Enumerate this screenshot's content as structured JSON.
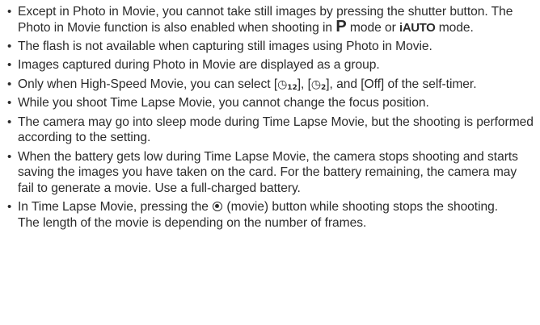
{
  "notes": {
    "item1": {
      "part1": "Except in Photo in Movie, you cannot take still images by pressing the shutter button. The Photo in Movie function is also enabled when shooting in ",
      "mode_p": "P",
      "part2": " mode or ",
      "mode_iauto": "iAUTO",
      "part3": " mode."
    },
    "item2": "The flash is not available when capturing still images using Photo in Movie.",
    "item3": "Images captured during Photo in Movie are displayed as a group.",
    "item4": {
      "part1": "Only when High-Speed Movie, you can select [",
      "timer_icon_1_sub": "12",
      "part2": "], [",
      "timer_icon_2_sub": "2",
      "part3": "], and [Off] of the self-timer."
    },
    "item5": "While you shoot Time Lapse Movie, you cannot change the focus position.",
    "item6": "The camera may go into sleep mode during Time Lapse Movie, but the shooting is performed according to the setting.",
    "item7": "When the battery gets low during Time Lapse Movie, the camera stops shooting and starts saving the images you have taken on the card. For the battery remaining, the camera may fail to generate a movie. Use a full-charged battery.",
    "item8": {
      "part1": "In Time Lapse Movie, pressing the ",
      "part2": " (movie) button while shooting stops the shooting.",
      "followup": "The length of the movie is depending on the number of frames."
    }
  },
  "icons": {
    "timer": "self-timer-icon",
    "movie": "movie-button-icon"
  }
}
